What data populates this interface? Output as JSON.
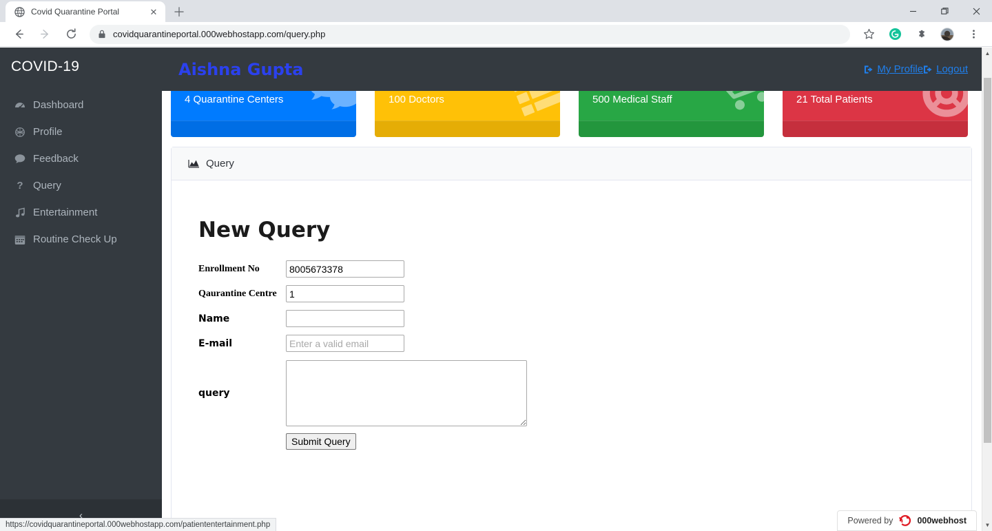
{
  "browser": {
    "tab": {
      "title": "Covid Quarantine Portal",
      "favicon_icon": "globe-icon",
      "close_icon": "close-icon"
    },
    "new_tab_icon": "plus-icon",
    "window_controls": {
      "minimize": "minimize-icon",
      "maximize": "maximize-icon",
      "close": "close-icon"
    },
    "nav": {
      "back_icon": "arrow-left-icon",
      "forward_icon": "arrow-right-icon",
      "reload_icon": "reload-icon"
    },
    "omnibox": {
      "lock_icon": "lock-icon",
      "url": "covidquarantineportal.000webhostapp.com/query.php"
    },
    "toolbar_icons": [
      "bookmark-star-icon",
      "grammarly-icon",
      "extensions-puzzle-icon",
      "profile-avatar",
      "chrome-menu-icon"
    ],
    "status_bar": {
      "link_preview": "https://covidquarantineportal.000webhostapp.com/patiententertainment.php"
    }
  },
  "sidebar": {
    "brand": "COVID-19",
    "items": [
      {
        "label": "Dashboard",
        "icon": "tachometer-icon",
        "glyph": "◔"
      },
      {
        "label": "Profile",
        "icon": "dna-icon",
        "glyph": "⬡"
      },
      {
        "label": "Feedback",
        "icon": "comment-icon",
        "glyph": "💬"
      },
      {
        "label": "Query",
        "icon": "question-icon",
        "glyph": "?"
      },
      {
        "label": "Entertainment",
        "icon": "music-note-icon",
        "glyph": "♪"
      },
      {
        "label": "Routine Check Up",
        "icon": "calendar-icon",
        "glyph": "☷"
      }
    ],
    "toggle": {
      "icon": "chevron-left-icon",
      "glyph": "‹"
    }
  },
  "topbar": {
    "user_name": "Aishna Gupta",
    "links": [
      {
        "label": "My Profile",
        "icon": "sign-out-icon"
      },
      {
        "label": "Logout",
        "icon": "sign-out-icon"
      }
    ]
  },
  "stat_cards": [
    {
      "label": "4 Quarantine Centers",
      "color": "#007bff",
      "icon": "comments-icon",
      "glyph": "💬"
    },
    {
      "label": "100 Doctors",
      "color": "#ffc107",
      "icon": "list-icon",
      "glyph": "≡"
    },
    {
      "label": "500 Medical Staff",
      "color": "#28a745",
      "icon": "cart-icon",
      "glyph": "🛒"
    },
    {
      "label": "21 Total Patients",
      "color": "#dc3545",
      "icon": "life-ring-icon",
      "glyph": "⎈"
    }
  ],
  "panel": {
    "header": {
      "title": "Query",
      "icon": "area-chart-icon"
    },
    "form": {
      "title": "New Query",
      "fields": [
        {
          "label": "Enrollment No",
          "name": "enrollment-no-field",
          "value": "8005673378",
          "placeholder": "",
          "style": "serif"
        },
        {
          "label": "Qaurantine Centre",
          "name": "quarantine-centre-field",
          "value": "1",
          "placeholder": "",
          "style": "serif"
        },
        {
          "label": "Name",
          "name": "name-field",
          "value": "",
          "placeholder": "",
          "style": "sans"
        },
        {
          "label": "E-mail",
          "name": "email-field",
          "value": "",
          "placeholder": "Enter a valid email",
          "style": "sans"
        }
      ],
      "textarea": {
        "label": "query",
        "value": "",
        "placeholder": ""
      },
      "submit_label": "Submit Query"
    }
  },
  "webhost_badge": {
    "prefix": "Powered by",
    "name": "000webhost",
    "logo_icon": "webhost-logo-icon"
  },
  "scrollbar": {
    "up_icon": "caret-up-icon",
    "down_icon": "caret-down-icon"
  }
}
